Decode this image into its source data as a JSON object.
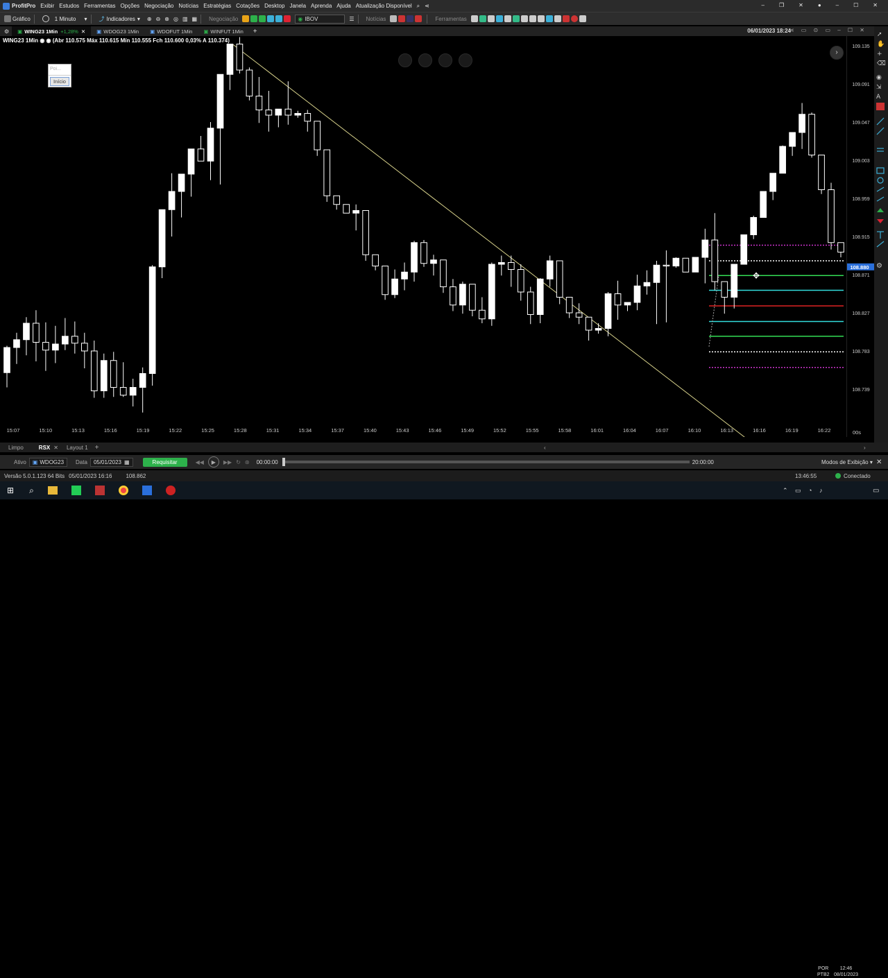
{
  "menubar": {
    "app": "ProfitPro",
    "items": [
      "Exibir",
      "Estudos",
      "Ferramentas",
      "Opções",
      "Negociação",
      "Notícias",
      "Estratégias",
      "Cotações",
      "Desktop",
      "Janela",
      "Aprenda",
      "Ajuda",
      "Atualização Disponível"
    ]
  },
  "toolbar": {
    "grafico": "Gráfico",
    "periodo": "1 Minuto",
    "indicadores": "Indicadores",
    "negociacao": "Negociação",
    "ativo_select": "IBOV",
    "noticias": "Notícias",
    "ferramentas": "Ferramentas"
  },
  "tabs": [
    {
      "label": "WING23 1Min",
      "change": "+1,28%"
    },
    {
      "label": "WDOG23 1Min"
    },
    {
      "label": "WDOFUT 1Min"
    },
    {
      "label": "WINFUT 1Min"
    }
  ],
  "tab_datetime": "06/01/2023 18:24",
  "chart_info": "WING23 1Min ◉ ◉ (Abr 110.575 Máx 110.615 Mín 110.555 Fch 110.600 0,03% A 110.374)",
  "popup": {
    "input_placeholder": "Poi...",
    "button": "Início"
  },
  "chart_data": {
    "type": "candlestick",
    "x_ticks": [
      "15:07",
      "15:10",
      "15:13",
      "15:16",
      "15:19",
      "15:22",
      "15:25",
      "15:28",
      "15:31",
      "15:34",
      "15:37",
      "15:40",
      "15:43",
      "15:46",
      "15:49",
      "15:52",
      "15:55",
      "15:58",
      "16:01",
      "16:04",
      "16:07",
      "16:10",
      "16:13",
      "16:16",
      "16:19",
      "16:22"
    ],
    "y_ticks": [
      "109.135",
      "109.091",
      "109.047",
      "109.003",
      "108.959",
      "108.915",
      "108.871",
      "108.827",
      "108.783",
      "108.739"
    ],
    "current_price": "108.880",
    "timer": "00s",
    "candles": [
      [
        108.758,
        108.789,
        108.741,
        108.787
      ],
      [
        108.787,
        108.804,
        108.768,
        108.796
      ],
      [
        108.796,
        108.822,
        108.778,
        108.815
      ],
      [
        108.815,
        108.83,
        108.771,
        108.793
      ],
      [
        108.793,
        108.816,
        108.76,
        108.784
      ],
      [
        108.784,
        108.812,
        108.769,
        108.791
      ],
      [
        108.791,
        108.821,
        108.784,
        108.8
      ],
      [
        108.8,
        108.817,
        108.78,
        108.792
      ],
      [
        108.792,
        108.804,
        108.763,
        108.783
      ],
      [
        108.783,
        108.795,
        108.729,
        108.737
      ],
      [
        108.737,
        108.78,
        108.729,
        108.772
      ],
      [
        108.772,
        108.782,
        108.73,
        108.741
      ],
      [
        108.741,
        108.77,
        108.73,
        108.732
      ],
      [
        108.732,
        108.751,
        108.719,
        108.741
      ],
      [
        108.741,
        108.764,
        108.712,
        108.757
      ],
      [
        108.757,
        108.882,
        108.743,
        108.88
      ],
      [
        108.88,
        108.924,
        108.867,
        108.946
      ],
      [
        108.946,
        108.988,
        108.915,
        108.967
      ],
      [
        108.967,
        108.974,
        108.937,
        108.987
      ],
      [
        108.987,
        109.016,
        108.961,
        109.016
      ],
      [
        109.016,
        109.031,
        109.002,
        109.002
      ],
      [
        109.002,
        109.047,
        108.98,
        109.04
      ],
      [
        109.04,
        109.102,
        108.975,
        109.102
      ],
      [
        109.102,
        109.137,
        109.084,
        109.137
      ],
      [
        109.137,
        109.145,
        109.103,
        109.107
      ],
      [
        109.107,
        109.11,
        109.072,
        109.077
      ],
      [
        109.077,
        109.099,
        109.046,
        109.061
      ],
      [
        109.061,
        109.083,
        109.036,
        109.055
      ],
      [
        109.055,
        109.06,
        109.041,
        109.062
      ],
      [
        109.062,
        109.094,
        109.044,
        109.055
      ],
      [
        109.055,
        109.06,
        109.052,
        109.057
      ],
      [
        109.057,
        109.061,
        109.036,
        109.048
      ],
      [
        109.048,
        109.048,
        109.008,
        109.015
      ],
      [
        109.015,
        108.99,
        108.955,
        108.962
      ],
      [
        108.962,
        108.962,
        108.946,
        108.952
      ],
      [
        108.952,
        108.945,
        108.946,
        108.942
      ],
      [
        108.942,
        108.952,
        108.922,
        108.945
      ],
      [
        108.945,
        108.935,
        108.887,
        108.894
      ],
      [
        108.894,
        108.894,
        108.876,
        108.881
      ],
      [
        108.881,
        108.877,
        108.842,
        108.848
      ],
      [
        108.848,
        108.877,
        108.844,
        108.866
      ],
      [
        108.866,
        108.885,
        108.853,
        108.874
      ],
      [
        108.874,
        108.91,
        108.863,
        108.908
      ],
      [
        108.908,
        108.911,
        108.88,
        108.884
      ],
      [
        108.884,
        108.894,
        108.87,
        108.888
      ],
      [
        108.888,
        108.868,
        108.85,
        108.857
      ],
      [
        108.857,
        108.866,
        108.829,
        108.836
      ],
      [
        108.836,
        108.863,
        108.826,
        108.86
      ],
      [
        108.86,
        108.853,
        108.823,
        108.83
      ],
      [
        108.83,
        108.845,
        108.815,
        108.82
      ],
      [
        108.82,
        108.885,
        108.812,
        108.883
      ],
      [
        108.883,
        108.893,
        108.87,
        108.885
      ],
      [
        108.885,
        108.893,
        108.857,
        108.877
      ],
      [
        108.877,
        108.883,
        108.841,
        108.851
      ],
      [
        108.851,
        108.857,
        108.814,
        108.825
      ],
      [
        108.825,
        108.867,
        108.815,
        108.866
      ],
      [
        108.866,
        108.893,
        108.857,
        108.887
      ],
      [
        108.887,
        108.876,
        108.837,
        108.845
      ],
      [
        108.845,
        108.835,
        108.821,
        108.827
      ],
      [
        108.827,
        108.838,
        108.814,
        108.822
      ],
      [
        108.822,
        108.809,
        108.795,
        108.807
      ],
      [
        108.807,
        108.815,
        108.803,
        108.809
      ],
      [
        108.809,
        108.851,
        108.8,
        108.849
      ],
      [
        108.849,
        108.864,
        108.819,
        108.836
      ],
      [
        108.836,
        108.833,
        108.829,
        108.839
      ],
      [
        108.839,
        108.871,
        108.83,
        108.858
      ],
      [
        108.858,
        108.876,
        108.848,
        108.862
      ],
      [
        108.862,
        108.887,
        108.814,
        108.882
      ],
      [
        108.882,
        108.899,
        108.816,
        108.881
      ],
      [
        108.881,
        108.891,
        108.879,
        108.89
      ],
      [
        108.89,
        108.879,
        108.891,
        108.874
      ],
      [
        108.874,
        108.879,
        108.874,
        108.891
      ],
      [
        108.891,
        108.924,
        108.861,
        108.911
      ],
      [
        108.911,
        108.942,
        108.853,
        108.863
      ],
      [
        108.863,
        108.843,
        108.826,
        108.845
      ],
      [
        108.845,
        108.882,
        108.832,
        108.883
      ],
      [
        108.883,
        108.909,
        108.886,
        108.917
      ],
      [
        108.917,
        108.939,
        108.912,
        108.937
      ],
      [
        108.937,
        108.962,
        108.954,
        108.967
      ],
      [
        108.967,
        108.981,
        108.957,
        108.988
      ],
      [
        108.988,
        109.02,
        108.992,
        109.019
      ],
      [
        109.019,
        109.034,
        109.008,
        109.035
      ],
      [
        109.035,
        109.069,
        109.016,
        109.056
      ],
      [
        109.056,
        109.058,
        109.006,
        109.009
      ],
      [
        109.009,
        108.984,
        108.964,
        108.969
      ],
      [
        108.969,
        108.977,
        108.9,
        108.908
      ],
      [
        108.908,
        108.908,
        108.891,
        108.897
      ]
    ],
    "overlays": {
      "trendline": "descending yellow",
      "levels": [
        {
          "color": "#cc33cc",
          "style": "dotted",
          "value": 108.905
        },
        {
          "color": "#ffffff",
          "style": "dotted",
          "value": 108.887
        },
        {
          "color": "#33dd55",
          "style": "solid",
          "value": 108.87
        },
        {
          "color": "#33dddd",
          "style": "solid",
          "value": 108.853
        },
        {
          "color": "#dd2222",
          "style": "solid",
          "value": 108.835
        },
        {
          "color": "#33dddd",
          "style": "solid",
          "value": 108.817
        },
        {
          "color": "#33dd55",
          "style": "solid",
          "value": 108.8
        },
        {
          "color": "#ffffff",
          "style": "dotted",
          "value": 108.782
        },
        {
          "color": "#cc33cc",
          "style": "dotted",
          "value": 108.764
        }
      ]
    }
  },
  "bottom_tabs": [
    "Limpo",
    "RSX",
    "Layout 1"
  ],
  "replay": {
    "ativo_label": "Ativo",
    "ativo": "WDOG23",
    "data_label": "Data",
    "data": "05/01/2023",
    "requisitar": "Requisitar",
    "start_time": "00:00:00",
    "end_time": "20:00:00",
    "modos": "Modos de Exibição"
  },
  "status": {
    "versao": "Versão 5.0.1.123 64 Bits",
    "datetime": "05/01/2023 16:16",
    "price": "108.862",
    "clock": "13:46:55",
    "conectado": "Conectado"
  },
  "taskbar": {
    "lang": "POR",
    "layout": "PTB2",
    "time": "12:46",
    "date": "08/01/2023"
  },
  "colors": {
    "bg": "#000000",
    "candle": "#ffffff",
    "trend": "#d6d08a",
    "price_tag": "#2a6fdb"
  }
}
